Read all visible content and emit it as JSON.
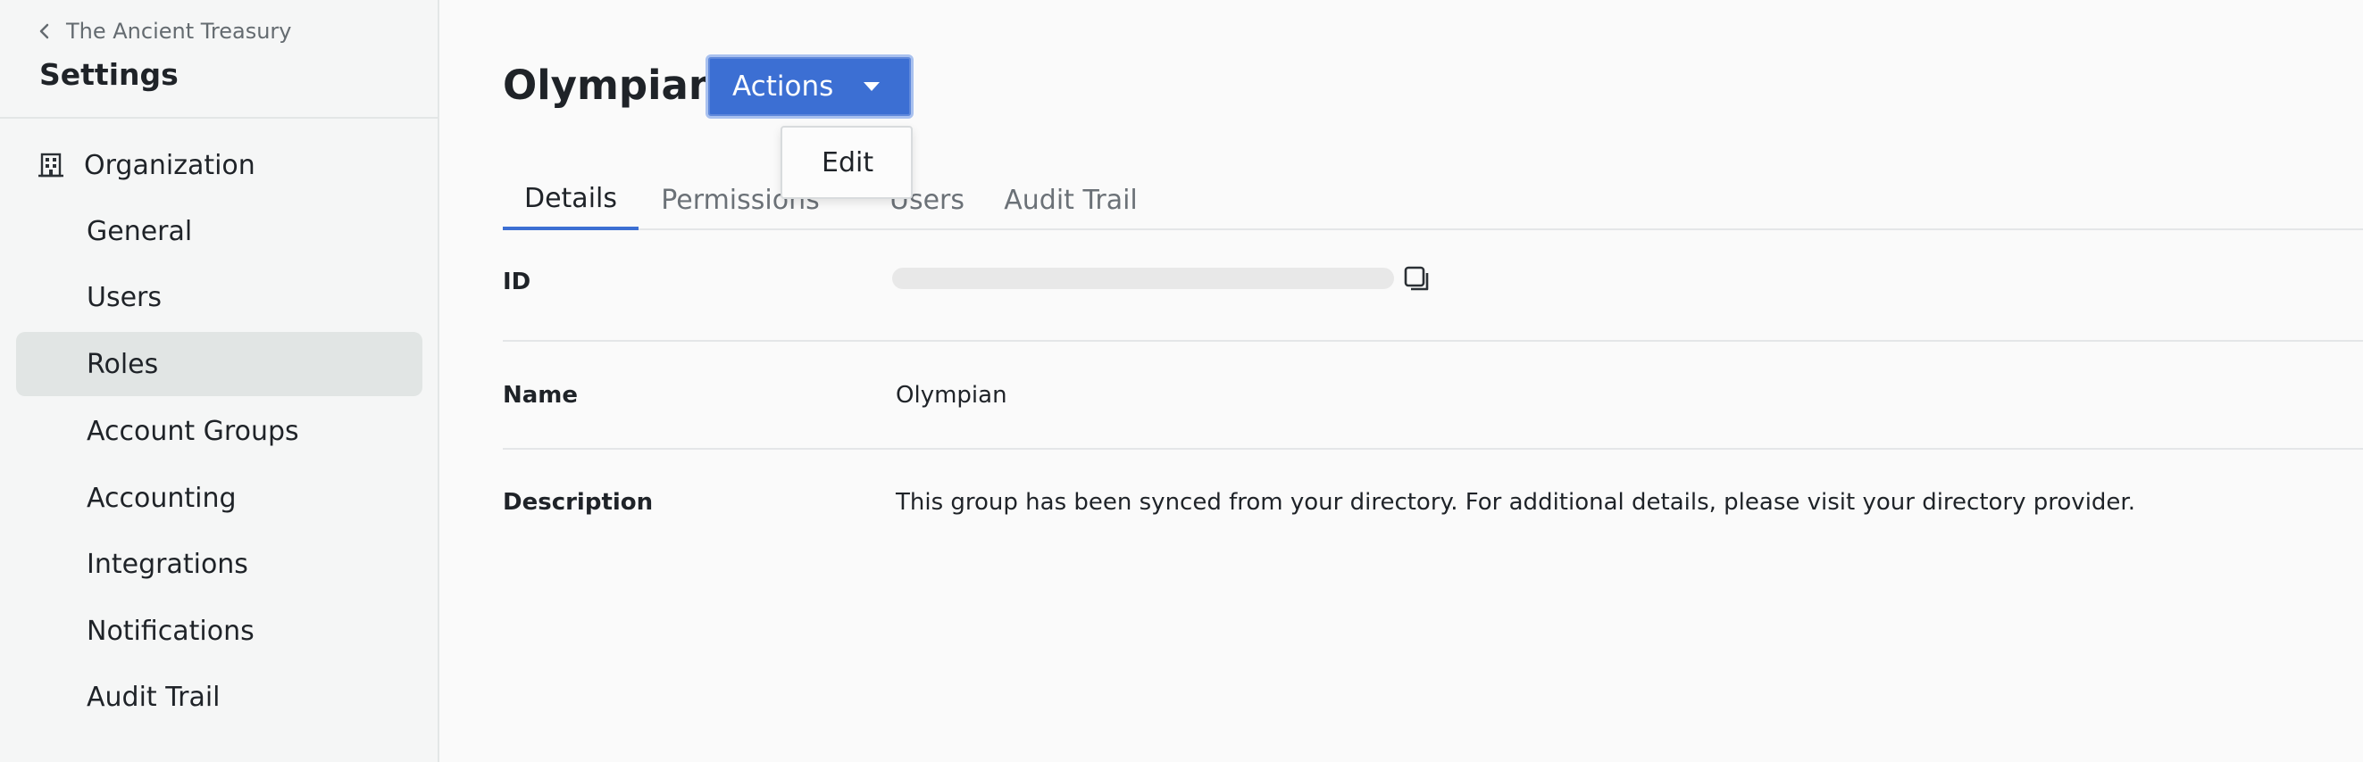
{
  "sidebar": {
    "back_label": "The Ancient Treasury",
    "title": "Settings",
    "section_label": "Organization",
    "items": [
      {
        "label": "General"
      },
      {
        "label": "Users"
      },
      {
        "label": "Roles",
        "active": true
      },
      {
        "label": "Account Groups"
      },
      {
        "label": "Accounting"
      },
      {
        "label": "Integrations"
      },
      {
        "label": "Notifications"
      },
      {
        "label": "Audit Trail"
      }
    ]
  },
  "header": {
    "title": "Olympian",
    "actions_label": "Actions",
    "dropdown": {
      "items": [
        {
          "label": "Edit"
        }
      ]
    }
  },
  "tabs": [
    {
      "label": "Details",
      "active": true
    },
    {
      "label": "Permissions"
    },
    {
      "label": "Users"
    },
    {
      "label": "Audit Trail"
    }
  ],
  "details": {
    "id_label": "ID",
    "id_value_loading": true,
    "name_label": "Name",
    "name_value": "Olympian",
    "description_label": "Description",
    "description_value": "This group has been synced from your directory. For additional details, please visit your directory provider."
  },
  "colors": {
    "accent": "#3c6fd3",
    "sidebar_bg": "#f5f6f6",
    "active_item_bg": "#e1e5e4"
  }
}
